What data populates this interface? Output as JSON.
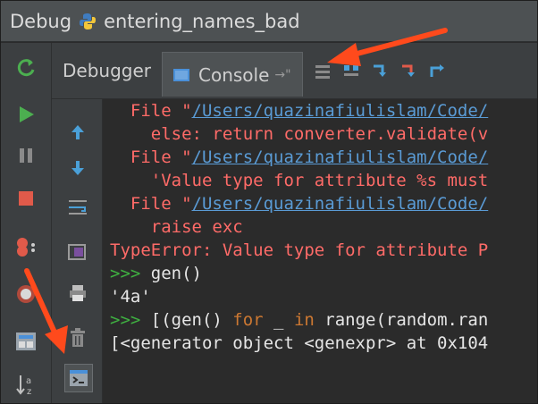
{
  "title_bar": {
    "label": "Debug",
    "config_name": "entering_names_bad"
  },
  "tabs": [
    {
      "label": "Debugger",
      "active": false
    },
    {
      "label": "Console",
      "active": true,
      "pin": "→\""
    }
  ],
  "console_lines": [
    {
      "parts": [
        {
          "t": "  File \"",
          "c": "err"
        },
        {
          "t": "/Users/quazinafiulislam/Code/",
          "c": "path"
        }
      ]
    },
    {
      "parts": [
        {
          "t": "    else: return converter.validate(v",
          "c": "err"
        }
      ]
    },
    {
      "parts": [
        {
          "t": "  File \"",
          "c": "err"
        },
        {
          "t": "/Users/quazinafiulislam/Code/",
          "c": "path"
        }
      ]
    },
    {
      "parts": [
        {
          "t": "    'Value type for attribute %s must",
          "c": "err"
        }
      ]
    },
    {
      "parts": [
        {
          "t": "  File \"",
          "c": "err"
        },
        {
          "t": "/Users/quazinafiulislam/Code/",
          "c": "path"
        }
      ]
    },
    {
      "parts": [
        {
          "t": "    raise exc",
          "c": "err"
        }
      ]
    },
    {
      "parts": [
        {
          "t": "TypeError: Value type for attribute P",
          "c": "err"
        }
      ]
    },
    {
      "parts": [
        {
          "t": ">>> ",
          "c": "prompt"
        },
        {
          "t": "gen()",
          "c": "code"
        }
      ]
    },
    {
      "parts": [
        {
          "t": "'4a'",
          "c": "code"
        }
      ]
    },
    {
      "parts": [
        {
          "t": ">>> ",
          "c": "prompt"
        },
        {
          "t": "[(gen() ",
          "c": "code"
        },
        {
          "t": "for",
          "c": "kw"
        },
        {
          "t": " _ ",
          "c": "code"
        },
        {
          "t": "in",
          "c": "kw"
        },
        {
          "t": " range(random.ran",
          "c": "code"
        }
      ]
    },
    {
      "parts": [
        {
          "t": "[<generator object <genexpr> at 0x104",
          "c": "code"
        }
      ]
    }
  ],
  "icons": {
    "left_rail": [
      "rerun-icon",
      "resume-icon",
      "pause-icon",
      "stop-icon",
      "view-breakpoints-icon",
      "mute-breakpoints-icon",
      "layout-icon",
      "sort-icon"
    ],
    "console_rail": [
      "up-arrow-icon",
      "down-arrow-icon",
      "soft-wrap-icon",
      "scroll-to-end-icon",
      "print-icon",
      "trash-icon",
      "show-python-prompt-icon"
    ]
  },
  "colors": {
    "error_text": "#ff6b68",
    "link_text": "#5a9bd5",
    "prompt": "#3fb041",
    "keyword": "#cc7832",
    "annotation_arrow": "#ff4a1c"
  }
}
